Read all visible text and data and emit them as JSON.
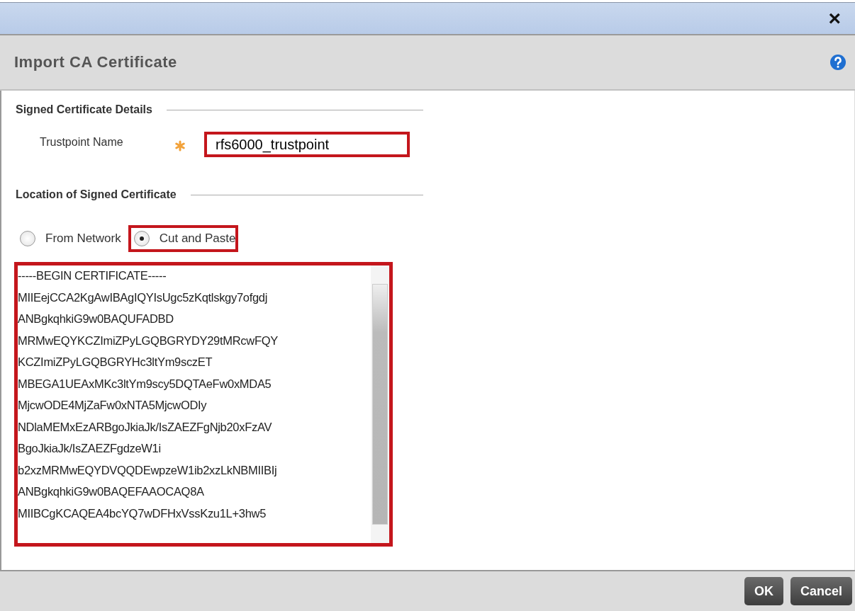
{
  "dialog": {
    "close_glyph": "×",
    "title": "Import CA Certificate"
  },
  "sections": [
    {
      "heading": "Signed Certificate Details"
    },
    {
      "heading": "Location of Signed Certificate"
    }
  ],
  "trustpoint": {
    "label": "Trustpoint Name",
    "required": true,
    "value": "rfs6000_trustpoint",
    "highlighted": true
  },
  "location_options": [
    {
      "label": "From Network",
      "selected": false,
      "highlighted": false
    },
    {
      "label": "Cut and Paste",
      "selected": true,
      "highlighted": true
    }
  ],
  "certificate": {
    "highlighted": true,
    "lines": [
      "-----BEGIN CERTIFICATE-----",
      "MIIEejCCA2KgAwIBAgIQYIsUgc5zKqtlskgy7ofgdj",
      "ANBgkqhkiG9w0BAQUFADBD",
      "MRMwEQYKCZImiZPyLGQBGRYDY29tMRcwFQY",
      "KCZImiZPyLGQBGRYHc3ltYm9sczET",
      "MBEGA1UEAxMKc3ltYm9scy5DQTAeFw0xMDA5",
      "MjcwODE4MjZaFw0xNTA5MjcwODIy",
      "NDlaMEMxEzARBgoJkiaJk/IsZAEZFgNjb20xFzAV",
      "BgoJkiaJk/IsZAEZFgdzeW1i",
      "b2xzMRMwEQYDVQQDEwpzeW1ib2xzLkNBMIIBIj",
      "ANBgkqhkiG9w0BAQEFAAOCAQ8A",
      "MIIBCgKCAQEA4bcYQ7wDFHxVssKzu1L+3hw5"
    ]
  },
  "buttons": [
    {
      "label": "OK"
    },
    {
      "label": "Cancel"
    }
  ]
}
